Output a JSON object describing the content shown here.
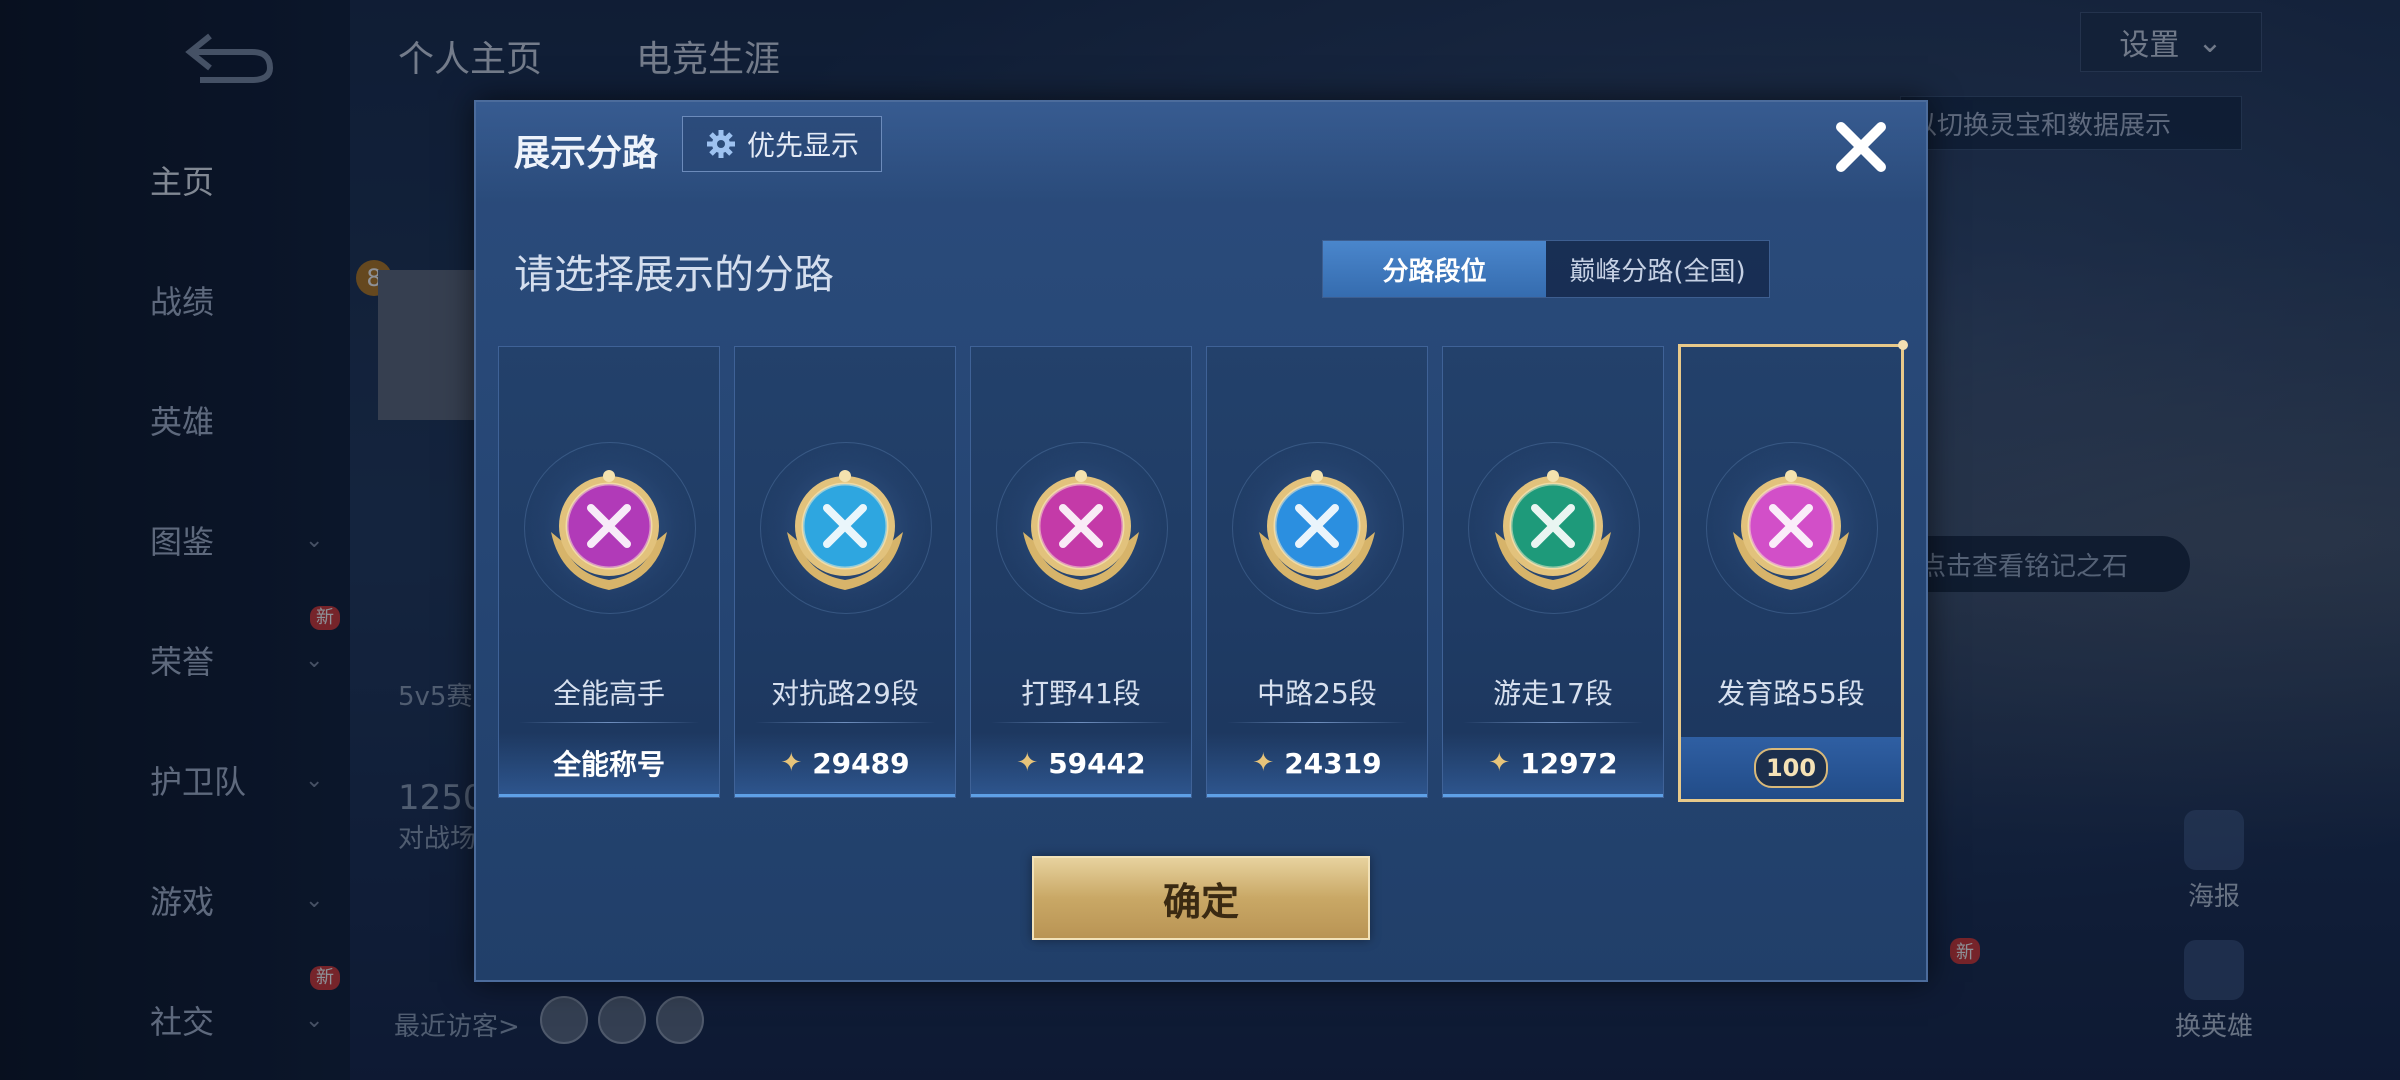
{
  "background": {
    "tabs": [
      "个人主页",
      "电竞生涯"
    ],
    "settings_label": "设置",
    "tip_banner": "以切换灵宝和数据展示",
    "stone_tip": "点击查看铭记之石",
    "sidebar": [
      {
        "label": "主页",
        "active": true,
        "chevron": false,
        "new": false
      },
      {
        "label": "战绩",
        "active": false,
        "chevron": false,
        "new": false
      },
      {
        "label": "英雄",
        "active": false,
        "chevron": false,
        "new": false
      },
      {
        "label": "图鉴",
        "active": false,
        "chevron": true,
        "new": false
      },
      {
        "label": "荣誉",
        "active": false,
        "chevron": true,
        "new": true
      },
      {
        "label": "护卫队",
        "active": false,
        "chevron": true,
        "new": false
      },
      {
        "label": "游戏",
        "active": false,
        "chevron": true,
        "new": false
      },
      {
        "label": "社交",
        "active": false,
        "chevron": true,
        "new": true
      }
    ],
    "new_badge": "新",
    "level_badge": "8",
    "mode_text": "5v5赛",
    "score_text": "1250",
    "battle_text": "对战场",
    "recent_visitors": "最近访客>",
    "right_actions": [
      "海报",
      "换英雄"
    ],
    "right_new_badge": "新"
  },
  "modal": {
    "title": "展示分路",
    "priority_button": "优先显示",
    "subtitle": "请选择展示的分路",
    "segments": [
      "分路段位",
      "巅峰分路(全国)"
    ],
    "cards": [
      {
        "label": "全能高手",
        "footer": "全能称号",
        "score": null,
        "color": "#b13ab8",
        "selected": false
      },
      {
        "label": "对抗路29段",
        "footer": null,
        "score": "29489",
        "color": "#2ea6e0",
        "selected": false
      },
      {
        "label": "打野41段",
        "footer": null,
        "score": "59442",
        "color": "#c43aa8",
        "selected": false
      },
      {
        "label": "中路25段",
        "footer": null,
        "score": "24319",
        "color": "#2b8fe0",
        "selected": false
      },
      {
        "label": "游走17段",
        "footer": null,
        "score": "12972",
        "color": "#1e9a7a",
        "selected": false
      },
      {
        "label": "发育路55段",
        "footer": null,
        "score": null,
        "star": "100",
        "color": "#d24fc8",
        "selected": true
      }
    ],
    "confirm_label": "确定"
  }
}
